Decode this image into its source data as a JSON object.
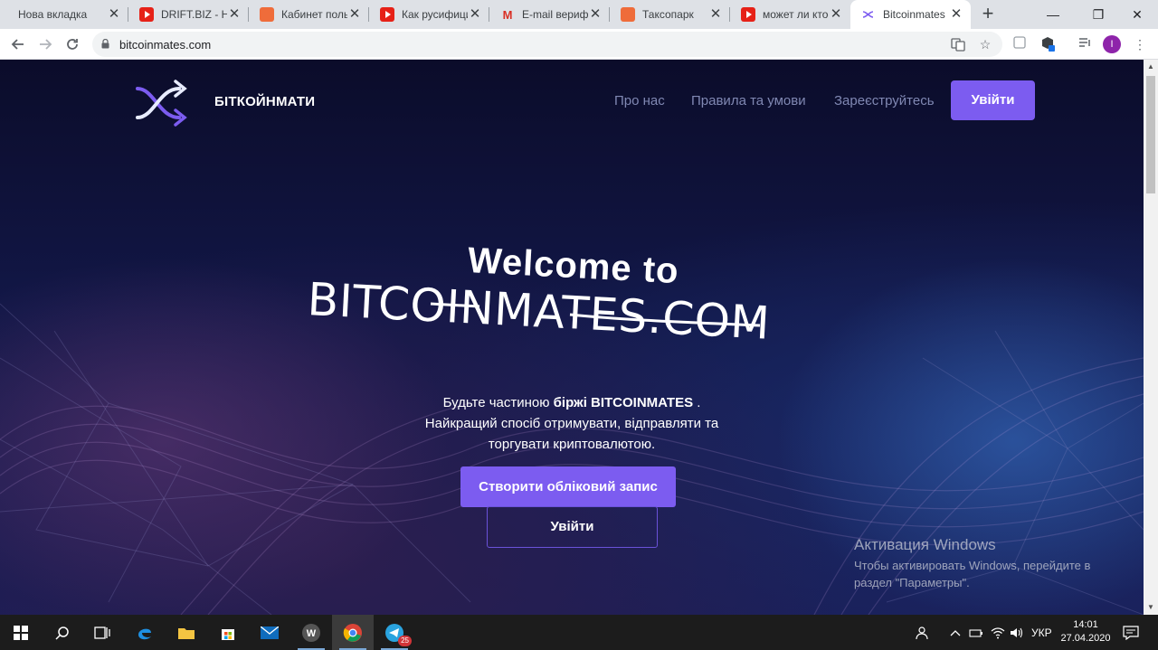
{
  "tabs": [
    {
      "title": "Нова вкладка",
      "icon": "none"
    },
    {
      "title": "DRIFT.BIZ - НОВ",
      "icon": "youtube-icon"
    },
    {
      "title": "Кабинет пользо",
      "icon": "orange-app-icon"
    },
    {
      "title": "Как русифициро",
      "icon": "youtube-icon"
    },
    {
      "title": "E-mail верифик",
      "icon": "gmail-icon"
    },
    {
      "title": "Таксопарк",
      "icon": "orange-app-icon"
    },
    {
      "title": "может ли кто-то",
      "icon": "youtube-icon"
    },
    {
      "title": "Bitcoinmates",
      "icon": "bitcoinmates-icon",
      "active": true
    }
  ],
  "tab_close_glyph": "✕",
  "new_tab_glyph": "+",
  "window_controls": {
    "minimize": "—",
    "maximize": "❐",
    "close": "✕"
  },
  "address_bar": {
    "url": "bitcoinmates.com"
  },
  "profile_initial": "I",
  "site": {
    "brand": "БІТКОЙНМАТИ",
    "nav": [
      "Про нас",
      "Правила та умови",
      "Зареєструйтесь"
    ],
    "login_button": "Увійти",
    "hero": {
      "welcome": "Welcome to",
      "title": "BITCOINMATES.COM",
      "text_part1": "Будьте частиною ",
      "text_bold": "біржі BITCOINMATES",
      "text_part2": " .",
      "text_line2": "Найкращий спосіб отримувати, відправляти та",
      "text_line3": "торгувати криптовалютою.",
      "create_button": "Створити обліковий запис",
      "login_button": "Увійти"
    }
  },
  "windows_activation": {
    "title": "Активация Windows",
    "line1": "Чтобы активировать Windows, перейдите в",
    "line2": "раздел \"Параметры\"."
  },
  "taskbar": {
    "telegram_badge": "25",
    "language": "УКР",
    "time": "14:01",
    "date": "27.04.2020"
  },
  "colors": {
    "accent": "#7c5cf0",
    "page_bg": "#121747",
    "nav_text": "#8088b3"
  }
}
